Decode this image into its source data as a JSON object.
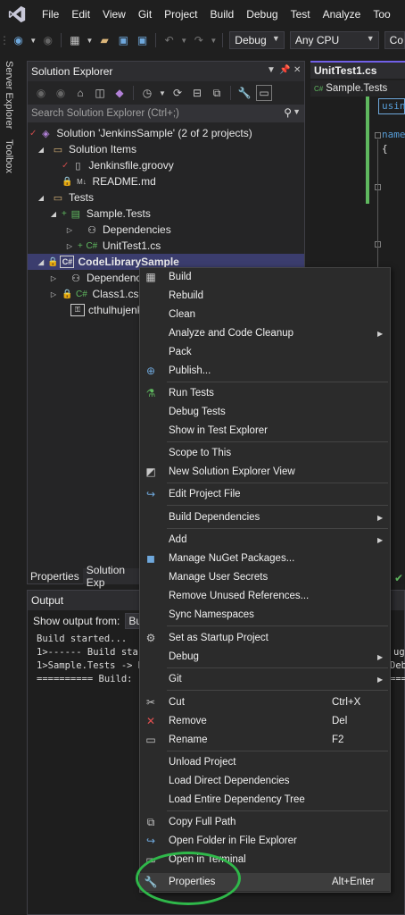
{
  "menubar": {
    "items": [
      "File",
      "Edit",
      "View",
      "Git",
      "Project",
      "Build",
      "Debug",
      "Test",
      "Analyze",
      "Too"
    ]
  },
  "toolbar": {
    "configuration": "Debug",
    "platform": "Any CPU",
    "startup_truncated": "Co"
  },
  "side_tabs": [
    "Server Explorer",
    "Toolbox"
  ],
  "solution_explorer": {
    "title": "Solution Explorer",
    "search_placeholder": "Search Solution Explorer (Ctrl+;)",
    "tree": [
      {
        "label": "Solution 'JenkinsSample' (2 of 2 projects)",
        "icon": "solution-icon"
      },
      {
        "label": "Solution Items",
        "icon": "folder-icon"
      },
      {
        "label": "Jenkinsfile.groovy",
        "icon": "file-icon"
      },
      {
        "label": "README.md",
        "icon": "markdown-icon"
      },
      {
        "label": "Tests",
        "icon": "folder-icon"
      },
      {
        "label": "Sample.Tests",
        "icon": "test-project-icon"
      },
      {
        "label": "Dependencies",
        "icon": "dependencies-icon"
      },
      {
        "label": "UnitTest1.cs",
        "icon": "csharp-file-icon"
      },
      {
        "label": "CodeLibrarySample",
        "icon": "csharp-project-icon"
      },
      {
        "label": "Dependenc",
        "icon": "dependencies-icon"
      },
      {
        "label": "Class1.cs",
        "icon": "csharp-file-icon"
      },
      {
        "label": "cthulhujenk",
        "icon": "snk-file-icon"
      }
    ]
  },
  "bottom_tabs": [
    "Properties",
    "Solution Exp"
  ],
  "editor": {
    "tab": "UnitTest1.cs",
    "breadcrumb": "Sample.Tests",
    "code_fragments": [
      "usin",
      "name",
      "{"
    ]
  },
  "output": {
    "title": "Output",
    "show_from_label": "Show output from:",
    "source_truncated": "Bui",
    "lines": [
      "Build started...",
      "1>------ Build star",
      "1>Sample.Tests -> D",
      "========== Build: 1"
    ],
    "right_fragments": [
      "ug",
      "Debu",
      "===="
    ]
  },
  "context_menu": [
    {
      "label": "Build",
      "icon": "build-icon"
    },
    {
      "label": "Rebuild"
    },
    {
      "label": "Clean"
    },
    {
      "label": "Analyze and Code Cleanup",
      "submenu": true
    },
    {
      "label": "Pack"
    },
    {
      "label": "Publish...",
      "icon": "globe-icon"
    },
    {
      "label": "Run Tests",
      "icon": "flask-icon"
    },
    {
      "label": "Debug Tests"
    },
    {
      "label": "Show in Test Explorer"
    },
    {
      "label": "Scope to This"
    },
    {
      "label": "New Solution Explorer View",
      "icon": "new-view-icon"
    },
    {
      "label": "Edit Project File",
      "icon": "edit-arrow-icon"
    },
    {
      "label": "Build Dependencies",
      "submenu": true
    },
    {
      "label": "Add",
      "submenu": true
    },
    {
      "label": "Manage NuGet Packages...",
      "icon": "nuget-icon"
    },
    {
      "label": "Manage User Secrets"
    },
    {
      "label": "Remove Unused References..."
    },
    {
      "label": "Sync Namespaces"
    },
    {
      "label": "Set as Startup Project",
      "icon": "gear-icon"
    },
    {
      "label": "Debug",
      "submenu": true
    },
    {
      "label": "Git",
      "submenu": true
    },
    {
      "label": "Cut",
      "shortcut": "Ctrl+X",
      "icon": "scissors-icon"
    },
    {
      "label": "Remove",
      "shortcut": "Del",
      "icon": "x-icon"
    },
    {
      "label": "Rename",
      "shortcut": "F2",
      "icon": "rename-icon"
    },
    {
      "label": "Unload Project"
    },
    {
      "label": "Load Direct Dependencies"
    },
    {
      "label": "Load Entire Dependency Tree"
    },
    {
      "label": "Copy Full Path",
      "icon": "copy-icon"
    },
    {
      "label": "Open Folder in File Explorer",
      "icon": "open-folder-icon"
    },
    {
      "label": "Open in Terminal",
      "icon": "terminal-icon"
    },
    {
      "label": "Properties",
      "shortcut": "Alt+Enter",
      "icon": "wrench-icon"
    }
  ],
  "colors": {
    "accent": "#7160e8",
    "selection": "#3b3d6e",
    "annotation_circle": "#2fb84a",
    "git_check": "#c94a4a"
  }
}
